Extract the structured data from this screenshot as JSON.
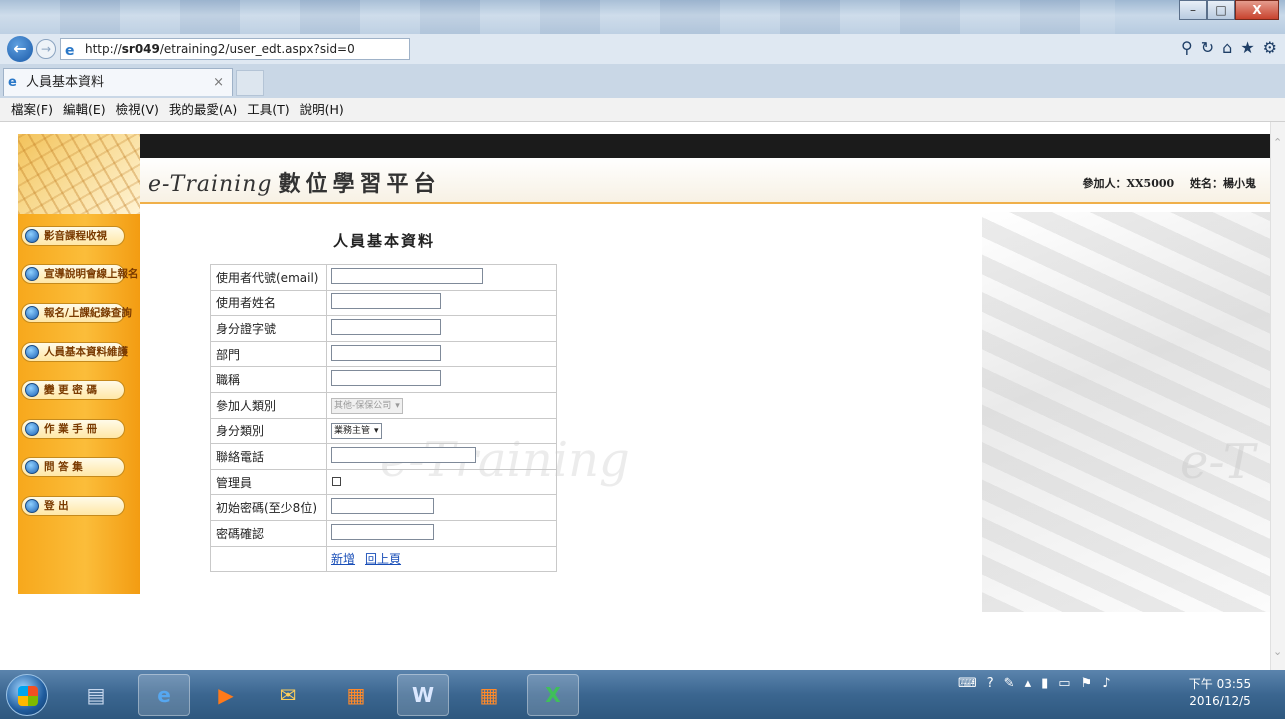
{
  "browser": {
    "url_prefix": "http://",
    "url_host": "sr049",
    "url_path": "/etraining2/user_edt.aspx?sid=0",
    "tab_title": "人員基本資料",
    "tab_close": "×",
    "window_min": "–",
    "window_max": "□",
    "window_close": "X"
  },
  "menu": [
    "檔案(F)",
    "編輯(E)",
    "檢視(V)",
    "我的最愛(A)",
    "工具(T)",
    "說明(H)"
  ],
  "site": {
    "title_en": "e-Training",
    "title_zh": "數位學習平台",
    "participant_label": "參加人：XX5000",
    "name_label": "姓名：楊小鬼",
    "watermark": "e-Training",
    "watermark_right": "e-T"
  },
  "sidebar": {
    "items": [
      {
        "label": "影音課程收視"
      },
      {
        "label": "宣導說明會線上報名"
      },
      {
        "label": "報名/上課紀錄查詢"
      },
      {
        "label": "人員基本資料維護"
      },
      {
        "label": "變 更 密 碼"
      },
      {
        "label": "作 業 手 冊"
      },
      {
        "label": "問 答 集"
      },
      {
        "label": "登 出"
      }
    ]
  },
  "form": {
    "title": "人員基本資料",
    "fields": {
      "email": {
        "label": "使用者代號(email)",
        "value": ""
      },
      "name": {
        "label": "使用者姓名",
        "value": ""
      },
      "id_no": {
        "label": "身分證字號",
        "value": ""
      },
      "dept": {
        "label": "部門",
        "value": ""
      },
      "job_title": {
        "label": "職稱",
        "value": ""
      },
      "participant_type": {
        "label": "參加人類別",
        "selected": "其他-保保公司"
      },
      "identity_type": {
        "label": "身分類別",
        "selected": "業務主管"
      },
      "phone": {
        "label": "聯絡電話",
        "value": ""
      },
      "admin": {
        "label": "管理員",
        "checked": false
      },
      "init_password": {
        "label": "初始密碼(至少8位)",
        "value": ""
      },
      "confirm_password": {
        "label": "密碼確認",
        "value": ""
      }
    },
    "actions": {
      "add": "新增",
      "back": "回上頁"
    }
  },
  "taskbar": {
    "clock_time": "下午 03:55",
    "clock_date": "2016/12/5"
  }
}
